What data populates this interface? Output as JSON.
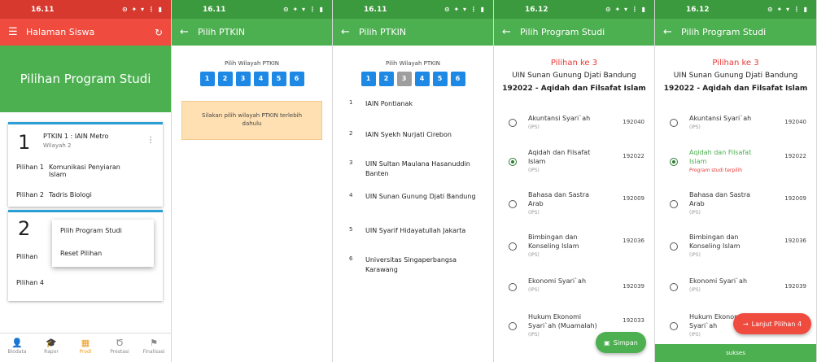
{
  "screen1": {
    "time": "16.11",
    "status_icons": "⊙ ✦ ▾ ⋮ ▮",
    "app_title": "Halaman Siswa",
    "hero_title": "Pilihan Program Studi",
    "card1": {
      "number": "1",
      "ptkin": "PTKIN 1 : IAIN Metro",
      "wilayah": "Wilayah 2",
      "rows": [
        {
          "label": "Pilihan 1",
          "value": "Komunikasi Penyiaran Islam"
        },
        {
          "label": "Pilihan 2",
          "value": "Tadris Biologi"
        }
      ]
    },
    "card2": {
      "number": "2",
      "rows": [
        {
          "label": "Pilihan",
          "value": ""
        },
        {
          "label": "Pilihan 4",
          "value": ""
        }
      ]
    },
    "popup": [
      "Pilih Program Studi",
      "Reset Pilihan"
    ],
    "nav": [
      "Biodata",
      "Rapor",
      "Prodi",
      "Prestasi",
      "Finalisasi"
    ]
  },
  "screen2": {
    "time": "16.11",
    "status_icons": "⊙ ✦ ▾ ⋮ ▮",
    "app_title": "Pilih PTKIN",
    "wilayah_label": "Pilih Wilayah PTKIN",
    "wilayah_buttons": [
      "1",
      "2",
      "3",
      "4",
      "5",
      "6"
    ],
    "warning": "Silakan pilih wilayah PTKIN terlebih dahulu"
  },
  "screen3": {
    "time": "16.11",
    "status_icons": "⊙ ✦ ▾ ⋮ ▮",
    "app_title": "Pilih PTKIN",
    "wilayah_label": "Pilih Wilayah PTKIN",
    "wilayah_buttons": [
      "1",
      "2",
      "3",
      "4",
      "5",
      "6"
    ],
    "selected_wilayah": "3",
    "ptkin_list": [
      {
        "no": "1",
        "name": "IAIN Pontianak"
      },
      {
        "no": "2",
        "name": "IAIN Syekh Nurjati Cirebon"
      },
      {
        "no": "3",
        "name": "UIN Sultan Maulana Hasanuddin Banten"
      },
      {
        "no": "4",
        "name": "UIN Sunan Gunung Djati Bandung"
      },
      {
        "no": "5",
        "name": "UIN Syarif Hidayatullah Jakarta"
      },
      {
        "no": "6",
        "name": "Universitas Singaperbangsa Karawang"
      }
    ]
  },
  "screen4": {
    "time": "16.12",
    "status_icons": "⊙ ✦ ▾ ⋮ ▮",
    "app_title": "Pilih Program Studi",
    "pilihan_ke": "Pilihan ke 3",
    "university": "UIN Sunan Gunung Djati Bandung",
    "program": "192022 - Aqidah dan Filsafat Islam",
    "studies": [
      {
        "name": "Akuntansi Syari`ah",
        "group": "(IPS)",
        "code": "192040",
        "selected": false
      },
      {
        "name": "Aqidah dan Filsafat Islam",
        "group": "(IPS)",
        "code": "192022",
        "selected": true
      },
      {
        "name": "Bahasa dan Sastra Arab",
        "group": "(IPS)",
        "code": "192009",
        "selected": false
      },
      {
        "name": "Bimbingan dan Konseling Islam",
        "group": "(IPS)",
        "code": "192036",
        "selected": false
      },
      {
        "name": "Ekonomi Syari`ah",
        "group": "(IPS)",
        "code": "192039",
        "selected": false
      },
      {
        "name": "Hukum Ekonomi Syari`ah (Muamalah)",
        "group": "(IPS)",
        "code": "192033",
        "selected": false
      }
    ],
    "save_label": "Simpan"
  },
  "screen5": {
    "time": "16.12",
    "status_icons": "⊙ ✦ ▾ ⋮ ▮",
    "app_title": "Pilih Program Studi",
    "pilihan_ke": "Pilihan ke 3",
    "university": "UIN Sunan Gunung Djati Bandung",
    "program": "192022 - Aqidah dan Filsafat Islam",
    "studies": [
      {
        "name": "Akuntansi Syari`ah",
        "group": "(IPS)",
        "code": "192040",
        "selected": false
      },
      {
        "name": "Aqidah dan Filsafat Islam",
        "group": "(IPS)",
        "code": "192022",
        "selected": true,
        "chosen": "Program studi terpilih"
      },
      {
        "name": "Bahasa dan Sastra Arab",
        "group": "(IPS)",
        "code": "192009",
        "selected": false
      },
      {
        "name": "Bimbingan dan Konseling Islam",
        "group": "(IPS)",
        "code": "192036",
        "selected": false
      },
      {
        "name": "Ekonomi Syari`ah",
        "group": "(IPS)",
        "code": "192039",
        "selected": false
      },
      {
        "name": "Hukum Ekonomi Syari`ah",
        "group": "(IPS)",
        "code": "",
        "selected": false
      }
    ],
    "next_label": "Lanjut Pilihan 4",
    "snackbar": "sukses"
  },
  "colors": {
    "red_bar": "#ef4b3e",
    "green_bar": "#4caf50",
    "blue_button": "#1e88e5",
    "active_nav": "#ef9c1b"
  }
}
